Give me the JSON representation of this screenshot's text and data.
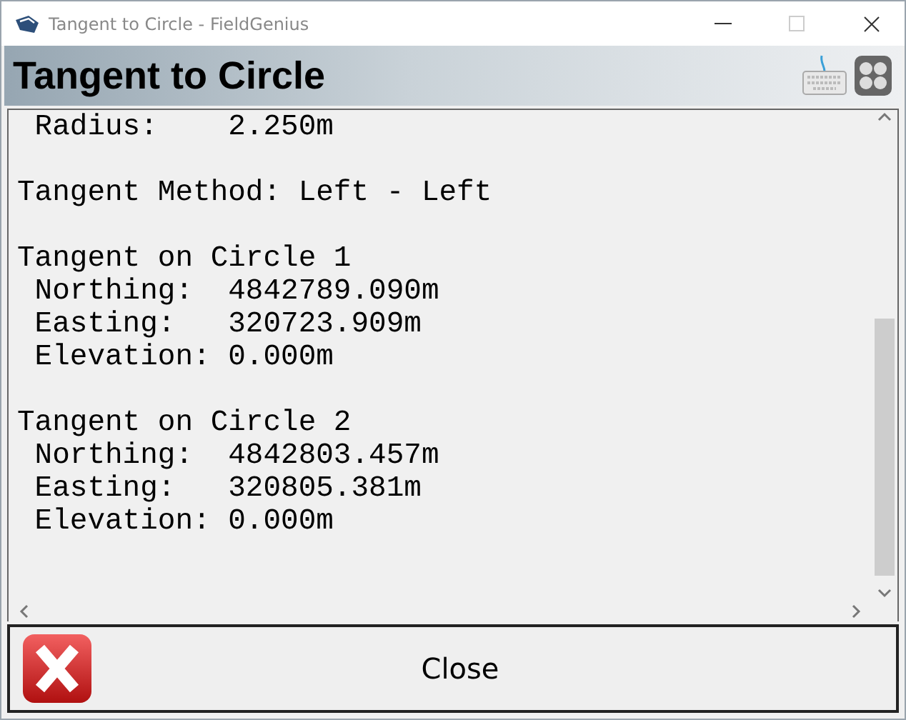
{
  "window": {
    "title": "Tangent to Circle - FieldGenius"
  },
  "header": {
    "title": "Tangent to Circle"
  },
  "report": {
    "sections": [
      [
        " Radius:    2.250m"
      ],
      [
        "Tangent Method: Left - Left"
      ],
      [
        "Tangent on Circle 1",
        " Northing:  4842789.090m",
        " Easting:   320723.909m",
        " Elevation: 0.000m"
      ],
      [
        "Tangent on Circle 2",
        " Northing:  4842803.457m",
        " Easting:   320805.381m",
        " Elevation: 0.000m"
      ]
    ]
  },
  "buttons": [
    {
      "label": "Close"
    }
  ]
}
